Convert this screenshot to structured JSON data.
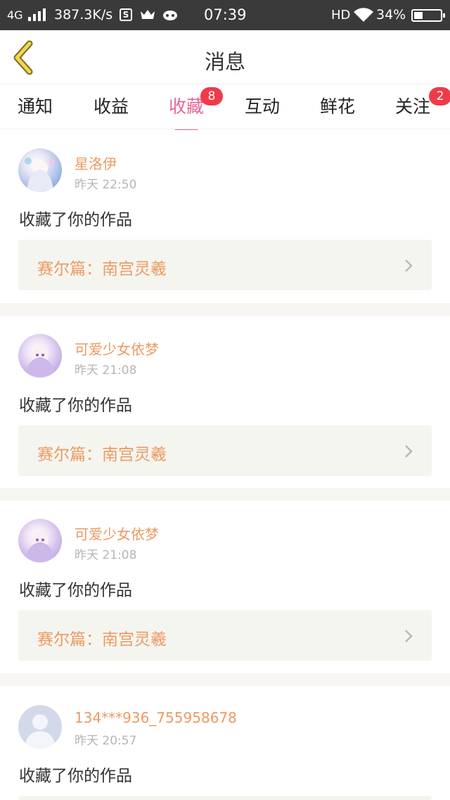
{
  "status_bar": {
    "network": "4G",
    "speed": "387.3K/s",
    "s_icon": "S",
    "time": "07:39",
    "hd": "HD",
    "battery": "34%"
  },
  "header": {
    "title": "消息"
  },
  "tabs": [
    {
      "label": "通知",
      "badge": ""
    },
    {
      "label": "收益",
      "badge": ""
    },
    {
      "label": "收藏",
      "badge": "8"
    },
    {
      "label": "互动",
      "badge": ""
    },
    {
      "label": "鲜花",
      "badge": ""
    },
    {
      "label": "关注",
      "badge": "2"
    }
  ],
  "messages": [
    {
      "user": "星洛伊",
      "time": "昨天 22:50",
      "text": "收藏了你的作品",
      "work": "赛尔篇：南宫灵羲"
    },
    {
      "user": "可爱少女依梦",
      "time": "昨天 21:08",
      "text": "收藏了你的作品",
      "work": "赛尔篇：南宫灵羲"
    },
    {
      "user": "可爱少女依梦",
      "time": "昨天 21:08",
      "text": "收藏了你的作品",
      "work": "赛尔篇：南宫灵羲"
    },
    {
      "user": "134***936_755958678",
      "time": "昨天 20:57",
      "text": "收藏了你的作品",
      "work": ""
    }
  ],
  "colors": {
    "accent": "#e5659a",
    "name": "#ec9a63",
    "badge": "#ee3b4a",
    "link_bg": "#f5f5ef"
  }
}
